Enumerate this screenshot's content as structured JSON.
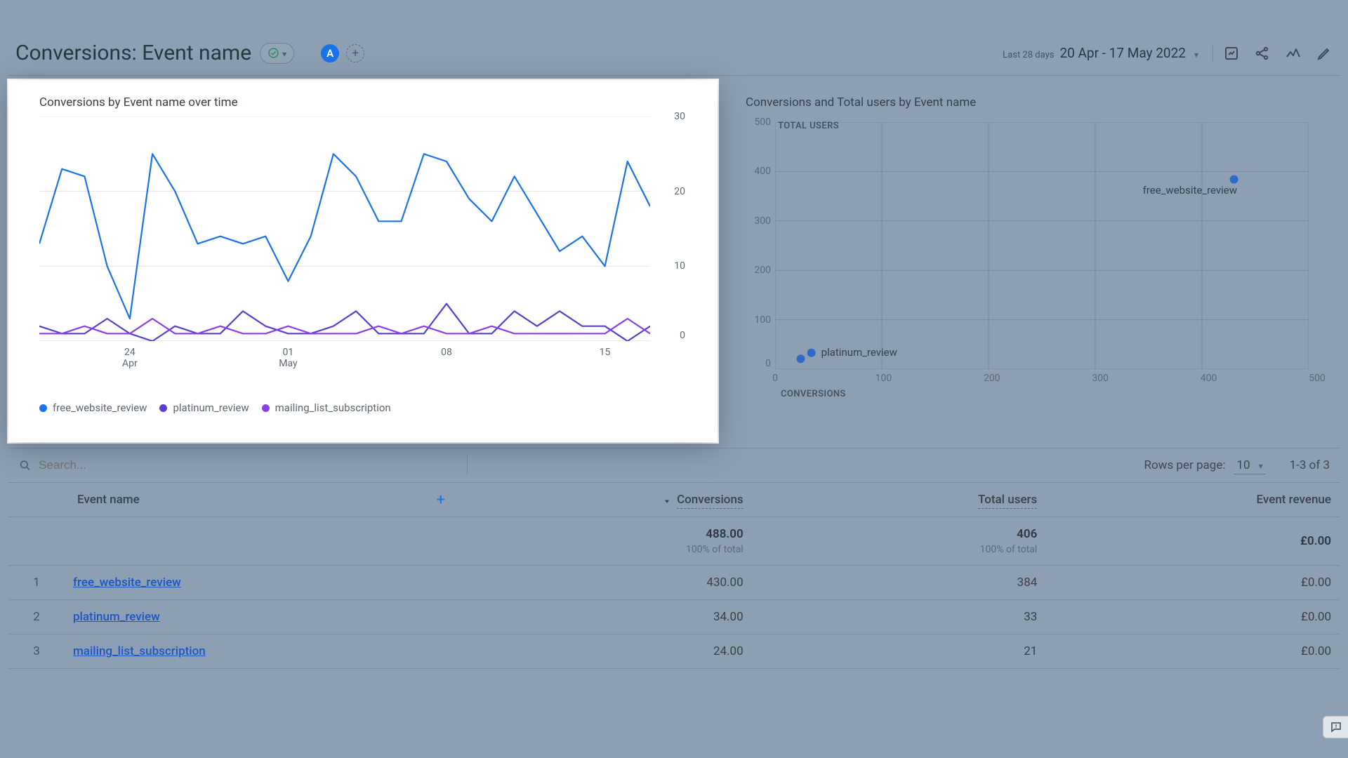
{
  "header": {
    "title": "Conversions: Event name",
    "badge_letter": "A",
    "add_label": "+",
    "date_prefix": "Last 28 days",
    "date_range": "20 Apr - 17 May 2022"
  },
  "panel_left": {
    "title": "Conversions by Event name over time"
  },
  "panel_right": {
    "title": "Conversions and Total users by Event name"
  },
  "legend": {
    "s1": {
      "label": "free_website_review",
      "color": "#1a73e8"
    },
    "s2": {
      "label": "platinum_review",
      "color": "#5a3fcf"
    },
    "s3": {
      "label": "mailing_list_subscription",
      "color": "#8a3fe8"
    }
  },
  "search": {
    "placeholder": "Search..."
  },
  "pagination": {
    "label": "Rows per page:",
    "value": "10",
    "range": "1-3 of 3"
  },
  "table": {
    "col_event": "Event name",
    "col_conv": "Conversions",
    "col_users": "Total users",
    "col_rev": "Event revenue",
    "total_conv": "488.00",
    "total_users": "406",
    "total_rev": "£0.00",
    "sub_conv": "100% of total",
    "sub_users": "100% of total",
    "rows": [
      {
        "idx": "1",
        "name": "free_website_review",
        "conv": "430.00",
        "users": "384",
        "rev": "£0.00"
      },
      {
        "idx": "2",
        "name": "platinum_review",
        "conv": "34.00",
        "users": "33",
        "rev": "£0.00"
      },
      {
        "idx": "3",
        "name": "mailing_list_subscription",
        "conv": "24.00",
        "users": "21",
        "rev": "£0.00"
      }
    ]
  },
  "chart_data": [
    {
      "type": "line",
      "title": "Conversions by Event name over time",
      "xlabel": "",
      "ylabel": "",
      "ylim": [
        0,
        30
      ],
      "x_ticks": [
        {
          "label": "24",
          "sublabel": "Apr"
        },
        {
          "label": "01",
          "sublabel": "May"
        },
        {
          "label": "08",
          "sublabel": ""
        },
        {
          "label": "15",
          "sublabel": ""
        }
      ],
      "x": [
        "20 Apr",
        "21 Apr",
        "22 Apr",
        "23 Apr",
        "24 Apr",
        "25 Apr",
        "26 Apr",
        "27 Apr",
        "28 Apr",
        "29 Apr",
        "30 Apr",
        "01 May",
        "02 May",
        "03 May",
        "04 May",
        "05 May",
        "06 May",
        "07 May",
        "08 May",
        "09 May",
        "10 May",
        "11 May",
        "12 May",
        "13 May",
        "14 May",
        "15 May",
        "16 May",
        "17 May"
      ],
      "series": [
        {
          "name": "free_website_review",
          "color": "#1a73e8",
          "values": [
            13,
            23,
            22,
            10,
            3,
            25,
            20,
            13,
            14,
            13,
            14,
            8,
            14,
            25,
            22,
            16,
            16,
            25,
            24,
            19,
            16,
            22,
            17,
            12,
            14,
            10,
            24,
            18
          ]
        },
        {
          "name": "platinum_review",
          "color": "#5a3fcf",
          "values": [
            2,
            1,
            1,
            3,
            1,
            0,
            2,
            1,
            1,
            4,
            2,
            1,
            1,
            2,
            4,
            1,
            1,
            1,
            5,
            1,
            1,
            4,
            2,
            4,
            2,
            2,
            0,
            2
          ]
        },
        {
          "name": "mailing_list_subscription",
          "color": "#8a3fe8",
          "values": [
            1,
            1,
            2,
            1,
            1,
            3,
            1,
            1,
            2,
            1,
            1,
            2,
            1,
            1,
            1,
            2,
            1,
            2,
            1,
            1,
            2,
            1,
            1,
            1,
            1,
            1,
            3,
            1
          ]
        }
      ]
    },
    {
      "type": "scatter",
      "title": "Conversions and Total users by Event name",
      "xlabel": "CONVERSIONS",
      "ylabel": "TOTAL USERS",
      "xlim": [
        0,
        500
      ],
      "ylim": [
        0,
        500
      ],
      "points": [
        {
          "name": "free_website_review",
          "x": 430,
          "y": 384,
          "label_shown": true
        },
        {
          "name": "platinum_review",
          "x": 34,
          "y": 33,
          "label_shown": true
        },
        {
          "name": "mailing_list_subscription",
          "x": 24,
          "y": 21,
          "label_shown": false
        }
      ],
      "color": "#3268c8"
    }
  ]
}
